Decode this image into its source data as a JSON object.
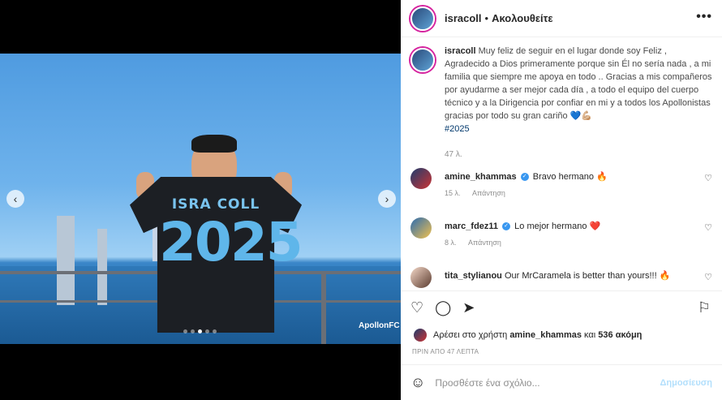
{
  "post": {
    "username": "isracoll",
    "separator": "•",
    "follow_status": "Ακολουθείτε",
    "more_label": "•••",
    "watermark": "ApollonFC",
    "jersey_name": "ISRA COLL",
    "jersey_number": "2025"
  },
  "caption": {
    "username": "isracoll",
    "text": "Muy feliz de seguir en el lugar donde soy Feliz , Agradecido a Dios primeramente porque sin Él no sería nada , a mi familia que siempre me apoya en todo .. Gracias a mis compañeros por ayudarme a ser mejor cada día , a todo el equipo del cuerpo técnico y a la Dirigencia por confiar en mi y a todos los Apollonistas gracias por todo su gran cariño 💙💪🏼",
    "hashtag": "#2025",
    "time": "47 λ."
  },
  "comments": [
    {
      "user": "amine_khammas",
      "verified": true,
      "text": "Bravo hermano 🔥",
      "time": "15 λ.",
      "reply": "Απάντηση"
    },
    {
      "user": "marc_fdez11",
      "verified": true,
      "text": "Lo mejor hermano ❤️",
      "time": "8 λ.",
      "reply": "Απάντηση"
    },
    {
      "user": "tita_stylianou",
      "verified": false,
      "text": "Our MrCaramela is better than yours!!! 🔥",
      "time": "",
      "reply": ""
    }
  ],
  "likes": {
    "prefix": "Αρέσει στο χρήστη",
    "user": "amine_khammas",
    "middle": "και",
    "count": "536 ακόμη"
  },
  "timeago": "ΠΡΙΝ ΑΠΟ 47 ΛΕΠΤΑ",
  "add_comment": {
    "placeholder": "Προσθέστε ένα σχόλιο...",
    "post_label": "Δημοσίευση"
  },
  "icons": {
    "heart": "♡",
    "comment": "◯",
    "share": "➤",
    "bookmark": "⚐",
    "emoji": "☺",
    "prev": "‹",
    "next": "›"
  },
  "colors": {
    "accent": "#3897f0",
    "story_ring": "#d6249f",
    "post_disabled": "#b2dffc"
  }
}
